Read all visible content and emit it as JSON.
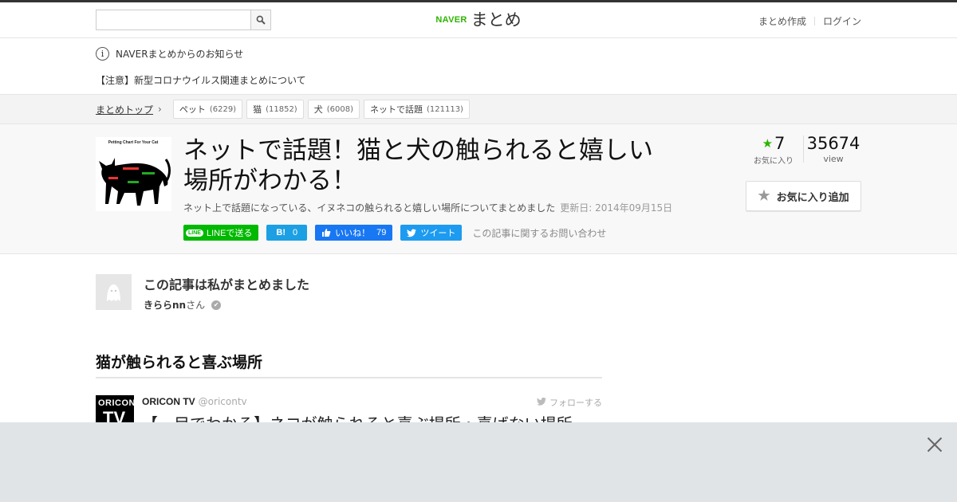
{
  "header": {
    "search_value": "",
    "logo_naver": "NAVER",
    "logo_matome": "まとめ",
    "nav": [
      "まとめ作成",
      "ログイン"
    ]
  },
  "notice": {
    "title": "NAVERまとめからのお知らせ",
    "item": "【注意】新型コロナウイルス関連まとめについて"
  },
  "breadcrumb": {
    "top": "まとめトップ",
    "tags": [
      {
        "label": "ペット",
        "count": "(6229)"
      },
      {
        "label": "猫",
        "count": "(11852)"
      },
      {
        "label": "犬",
        "count": "(6008)"
      },
      {
        "label": "ネットで話題",
        "count": "(121113)"
      }
    ]
  },
  "article": {
    "thumb_caption": "Petting Chart For Your Cat",
    "title": "ネットで話題！猫と犬の触られると嬉しい場所がわかる！",
    "description": "ネット上で話題になっている、イヌネコの触られると嬉しい場所についてまとめました",
    "updated": "更新日: 2014年09月15日",
    "share": {
      "line": "LINEで送る",
      "hatena_icon": "B!",
      "hatena_count": "0",
      "fb_label": "いいね！",
      "fb_count": "79",
      "tweet": "ツイート",
      "inquiry": "この記事に関するお問い合わせ"
    },
    "stats": {
      "fav_count": "7",
      "fav_label": "お気に入り",
      "view_count": "35674",
      "view_label": "view"
    },
    "fav_button": "お気に入り追加"
  },
  "author": {
    "heading": "この記事は私がまとめました",
    "name": "きららnn",
    "suffix": "さん"
  },
  "section": {
    "title": "猫が触られると喜ぶ場所"
  },
  "tweet": {
    "avatar_l1": "ORICON",
    "avatar_l2": "TV",
    "user": "ORICON TV",
    "handle": "@oricontv",
    "follow": "フォローする",
    "text": "【一目でわかる】ネコが触られると喜ぶ場所・喜ばない場所"
  },
  "colors": {
    "naver_green": "#2db400",
    "line_green": "#00b900",
    "hatena_blue": "#1d9fe3",
    "fb_blue": "#1877f2",
    "twitter_blue": "#1d9bf0"
  }
}
